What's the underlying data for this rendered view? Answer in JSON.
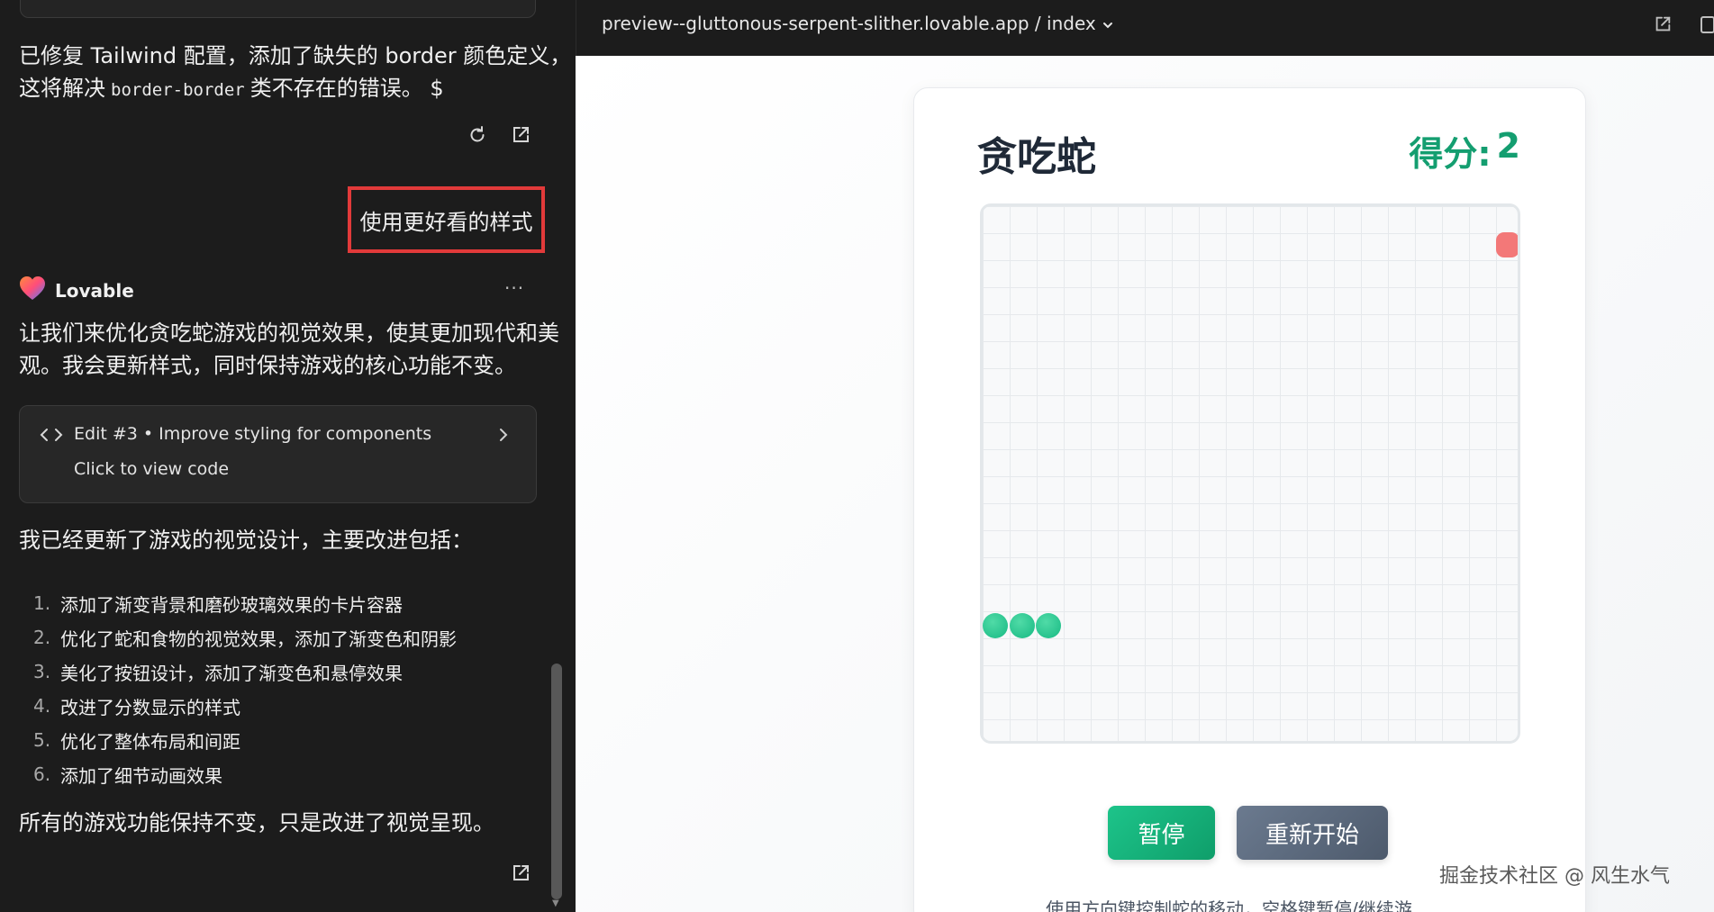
{
  "chat": {
    "fix_message_line1": "已修复 Tailwind 配置，添加了缺失的 border 颜色定义，",
    "fix_message_line2_pre": "这将解决",
    "fix_message_code": "border-border",
    "fix_message_line2_post": "类不存在的错误。",
    "user_message": "使用更好看的样式",
    "assistant_name": "Lovable",
    "more_label": "···",
    "intro_line1": "让我们来优化贪吃蛇游戏的视觉效果，使其更加现代和美",
    "intro_line2": "观。我会更新样式，同时保持游戏的核心功能不变。",
    "edit_card": {
      "title": "Edit #3 • Improve styling for components",
      "subtitle": "Click to view code"
    },
    "summary_heading": "我已经更新了游戏的视觉设计，主要改进包括：",
    "improvements": [
      {
        "num": "1.",
        "text": "添加了渐变背景和磨砂玻璃效果的卡片容器"
      },
      {
        "num": "2.",
        "text": "优化了蛇和食物的视觉效果，添加了渐变色和阴影"
      },
      {
        "num": "3.",
        "text": "美化了按钮设计，添加了渐变色和悬停效果"
      },
      {
        "num": "4.",
        "text": "改进了分数显示的样式"
      },
      {
        "num": "5.",
        "text": "优化了整体布局和间距"
      },
      {
        "num": "6.",
        "text": "添加了细节动画效果"
      }
    ],
    "closing": "所有的游戏功能保持不变，只是改进了视觉呈现。",
    "icons": [
      "refresh-icon",
      "external-link-icon",
      "code-icon",
      "chevron-right-icon",
      "lovable-heart-icon"
    ]
  },
  "preview": {
    "url": "preview--gluttonous-serpent-slither.lovable.app / index"
  },
  "game": {
    "title": "贪吃蛇",
    "score_label": "得分:",
    "score_value": "2",
    "pause_label": "暂停",
    "restart_label": "重新开始",
    "instructions": "使用方向键控制蛇的移动，空格键暂停/继续游",
    "colors": {
      "snake": "#2ecc91",
      "food": "#f37878",
      "accent": "#149e70"
    }
  },
  "watermark": "掘金技术社区 @ 风生水气"
}
